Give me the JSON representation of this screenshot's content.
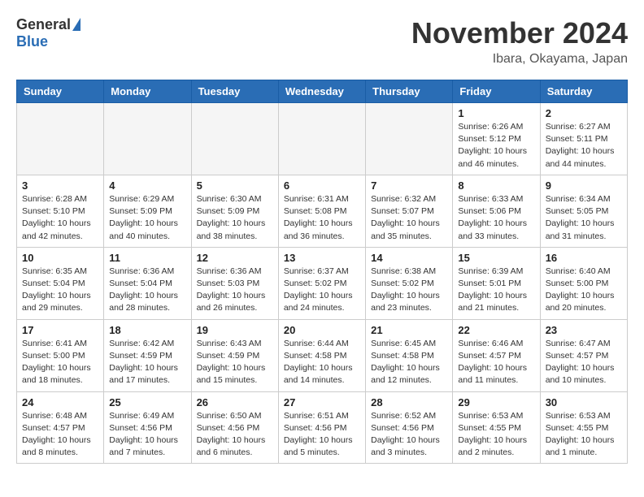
{
  "header": {
    "logo_general": "General",
    "logo_blue": "Blue",
    "month_title": "November 2024",
    "location": "Ibara, Okayama, Japan"
  },
  "columns": [
    "Sunday",
    "Monday",
    "Tuesday",
    "Wednesday",
    "Thursday",
    "Friday",
    "Saturday"
  ],
  "weeks": [
    [
      {
        "day": "",
        "info": ""
      },
      {
        "day": "",
        "info": ""
      },
      {
        "day": "",
        "info": ""
      },
      {
        "day": "",
        "info": ""
      },
      {
        "day": "",
        "info": ""
      },
      {
        "day": "1",
        "info": "Sunrise: 6:26 AM\nSunset: 5:12 PM\nDaylight: 10 hours and 46 minutes."
      },
      {
        "day": "2",
        "info": "Sunrise: 6:27 AM\nSunset: 5:11 PM\nDaylight: 10 hours and 44 minutes."
      }
    ],
    [
      {
        "day": "3",
        "info": "Sunrise: 6:28 AM\nSunset: 5:10 PM\nDaylight: 10 hours and 42 minutes."
      },
      {
        "day": "4",
        "info": "Sunrise: 6:29 AM\nSunset: 5:09 PM\nDaylight: 10 hours and 40 minutes."
      },
      {
        "day": "5",
        "info": "Sunrise: 6:30 AM\nSunset: 5:09 PM\nDaylight: 10 hours and 38 minutes."
      },
      {
        "day": "6",
        "info": "Sunrise: 6:31 AM\nSunset: 5:08 PM\nDaylight: 10 hours and 36 minutes."
      },
      {
        "day": "7",
        "info": "Sunrise: 6:32 AM\nSunset: 5:07 PM\nDaylight: 10 hours and 35 minutes."
      },
      {
        "day": "8",
        "info": "Sunrise: 6:33 AM\nSunset: 5:06 PM\nDaylight: 10 hours and 33 minutes."
      },
      {
        "day": "9",
        "info": "Sunrise: 6:34 AM\nSunset: 5:05 PM\nDaylight: 10 hours and 31 minutes."
      }
    ],
    [
      {
        "day": "10",
        "info": "Sunrise: 6:35 AM\nSunset: 5:04 PM\nDaylight: 10 hours and 29 minutes."
      },
      {
        "day": "11",
        "info": "Sunrise: 6:36 AM\nSunset: 5:04 PM\nDaylight: 10 hours and 28 minutes."
      },
      {
        "day": "12",
        "info": "Sunrise: 6:36 AM\nSunset: 5:03 PM\nDaylight: 10 hours and 26 minutes."
      },
      {
        "day": "13",
        "info": "Sunrise: 6:37 AM\nSunset: 5:02 PM\nDaylight: 10 hours and 24 minutes."
      },
      {
        "day": "14",
        "info": "Sunrise: 6:38 AM\nSunset: 5:02 PM\nDaylight: 10 hours and 23 minutes."
      },
      {
        "day": "15",
        "info": "Sunrise: 6:39 AM\nSunset: 5:01 PM\nDaylight: 10 hours and 21 minutes."
      },
      {
        "day": "16",
        "info": "Sunrise: 6:40 AM\nSunset: 5:00 PM\nDaylight: 10 hours and 20 minutes."
      }
    ],
    [
      {
        "day": "17",
        "info": "Sunrise: 6:41 AM\nSunset: 5:00 PM\nDaylight: 10 hours and 18 minutes."
      },
      {
        "day": "18",
        "info": "Sunrise: 6:42 AM\nSunset: 4:59 PM\nDaylight: 10 hours and 17 minutes."
      },
      {
        "day": "19",
        "info": "Sunrise: 6:43 AM\nSunset: 4:59 PM\nDaylight: 10 hours and 15 minutes."
      },
      {
        "day": "20",
        "info": "Sunrise: 6:44 AM\nSunset: 4:58 PM\nDaylight: 10 hours and 14 minutes."
      },
      {
        "day": "21",
        "info": "Sunrise: 6:45 AM\nSunset: 4:58 PM\nDaylight: 10 hours and 12 minutes."
      },
      {
        "day": "22",
        "info": "Sunrise: 6:46 AM\nSunset: 4:57 PM\nDaylight: 10 hours and 11 minutes."
      },
      {
        "day": "23",
        "info": "Sunrise: 6:47 AM\nSunset: 4:57 PM\nDaylight: 10 hours and 10 minutes."
      }
    ],
    [
      {
        "day": "24",
        "info": "Sunrise: 6:48 AM\nSunset: 4:57 PM\nDaylight: 10 hours and 8 minutes."
      },
      {
        "day": "25",
        "info": "Sunrise: 6:49 AM\nSunset: 4:56 PM\nDaylight: 10 hours and 7 minutes."
      },
      {
        "day": "26",
        "info": "Sunrise: 6:50 AM\nSunset: 4:56 PM\nDaylight: 10 hours and 6 minutes."
      },
      {
        "day": "27",
        "info": "Sunrise: 6:51 AM\nSunset: 4:56 PM\nDaylight: 10 hours and 5 minutes."
      },
      {
        "day": "28",
        "info": "Sunrise: 6:52 AM\nSunset: 4:56 PM\nDaylight: 10 hours and 3 minutes."
      },
      {
        "day": "29",
        "info": "Sunrise: 6:53 AM\nSunset: 4:55 PM\nDaylight: 10 hours and 2 minutes."
      },
      {
        "day": "30",
        "info": "Sunrise: 6:53 AM\nSunset: 4:55 PM\nDaylight: 10 hours and 1 minute."
      }
    ]
  ]
}
